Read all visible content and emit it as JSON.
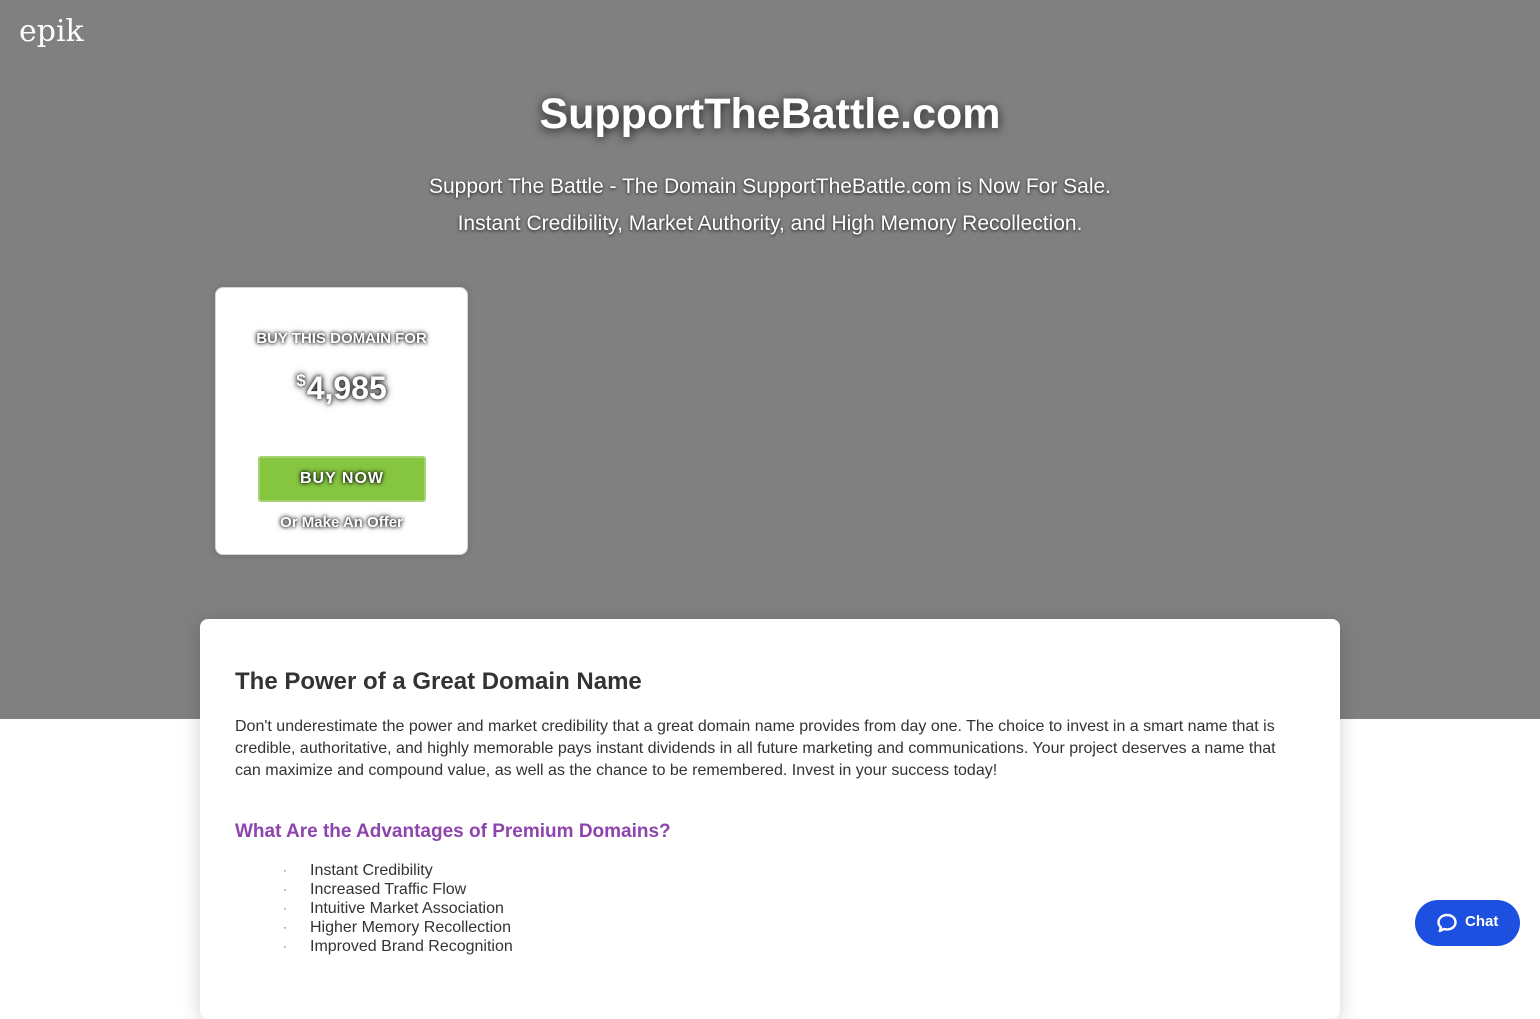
{
  "header": {
    "logo": "epik"
  },
  "hero": {
    "domain": "SupportTheBattle.com",
    "subtitle_line1": "Support The Battle - The Domain SupportTheBattle.com is Now For Sale.",
    "subtitle_line2": "Instant Credibility, Market Authority, and High Memory Recollection."
  },
  "buy_card": {
    "label": "BUY THIS DOMAIN FOR",
    "currency_symbol": "$",
    "price": "4,985",
    "buy_button": "BUY NOW",
    "offer_link": "Or Make An Offer"
  },
  "content": {
    "heading": "The Power of a Great Domain Name",
    "paragraph": "Don't underestimate the power and market credibility that a great domain name provides from day one. The choice to invest in a smart name that is credible, authoritative, and highly memorable pays instant dividends in all future marketing and communications. Your project deserves a name that can maximize and compound value, as well as the chance to be remembered. Invest in your success today!",
    "advantages_heading": "What Are the Advantages of Premium Domains?",
    "advantages": [
      "Instant Credibility",
      "Increased Traffic Flow",
      "Intuitive Market Association",
      "Higher Memory Recollection",
      "Improved Brand Recognition"
    ]
  },
  "chat": {
    "label": "Chat",
    "icon": "chat-bubble-icon"
  },
  "colors": {
    "hero_bg": "#808080",
    "buy_button": "#85c540",
    "advantages_heading": "#8e44ad",
    "chat_button": "#1d4fe0"
  }
}
